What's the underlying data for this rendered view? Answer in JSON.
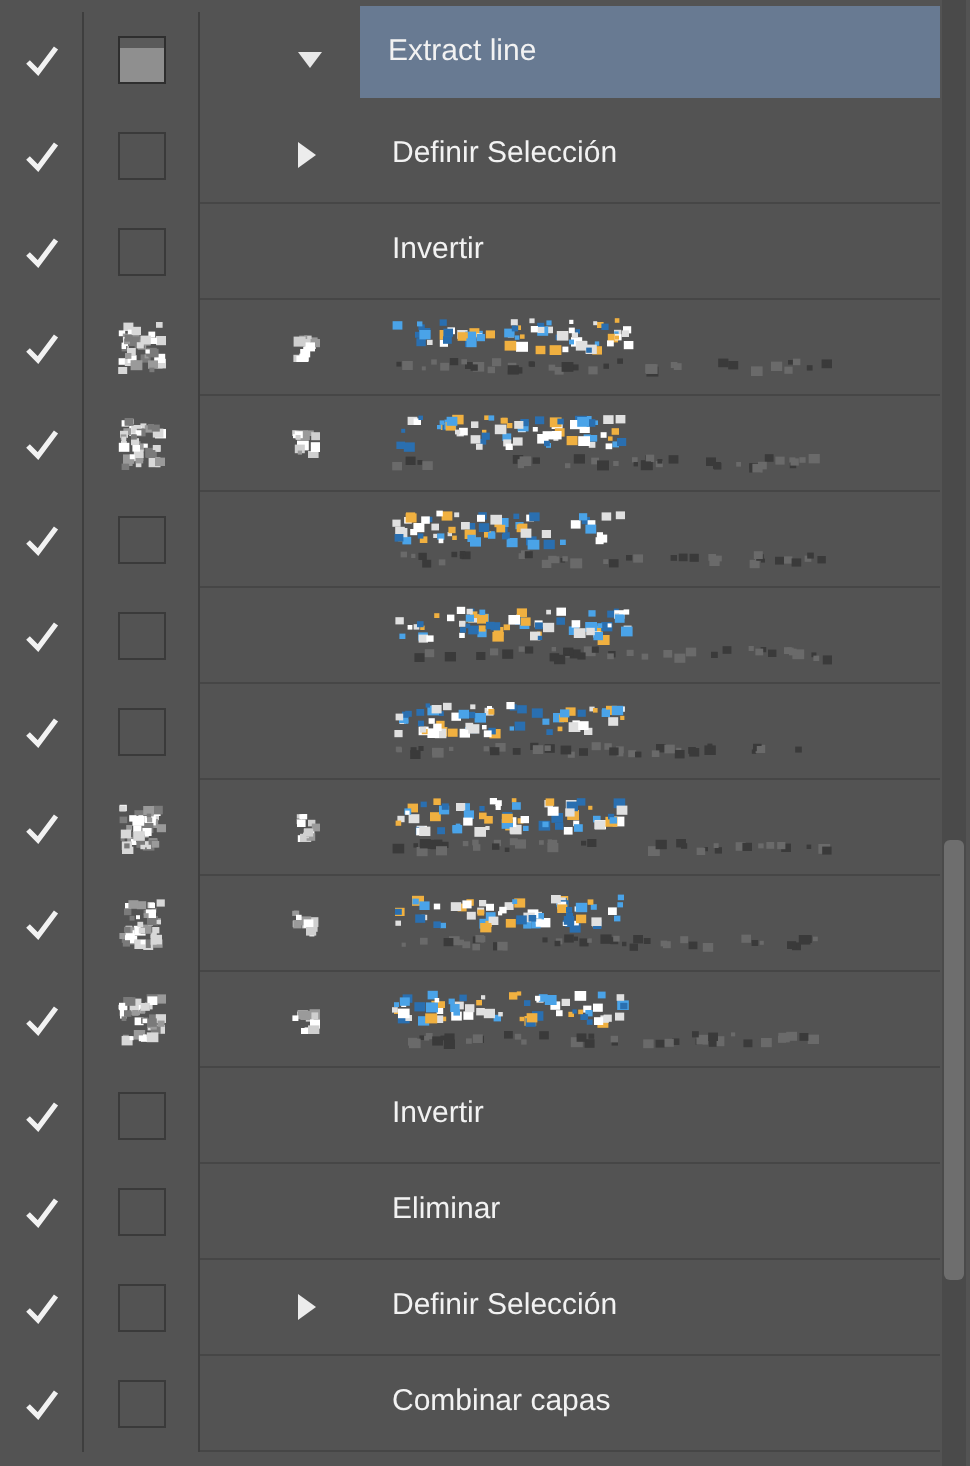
{
  "action": {
    "label": "Extract line",
    "selected": true,
    "expanded": true,
    "checked": true,
    "dialog": true,
    "children": [
      {
        "kind": "step",
        "label": "Definir Selección",
        "checked": true,
        "dialog": false,
        "expandable": true
      },
      {
        "kind": "step",
        "label": "Invertir",
        "checked": true,
        "dialog": false,
        "expandable": false
      },
      {
        "kind": "garbled",
        "checked": true,
        "dialog": true,
        "expandable": true
      },
      {
        "kind": "garbled",
        "checked": true,
        "dialog": true,
        "expandable": true
      },
      {
        "kind": "garbled",
        "checked": true,
        "dialog": false,
        "expandable": false
      },
      {
        "kind": "garbled",
        "checked": true,
        "dialog": false,
        "expandable": false
      },
      {
        "kind": "garbled",
        "checked": true,
        "dialog": false,
        "expandable": false
      },
      {
        "kind": "garbled",
        "checked": true,
        "dialog": true,
        "expandable": true
      },
      {
        "kind": "garbled",
        "checked": true,
        "dialog": true,
        "expandable": true
      },
      {
        "kind": "garbled",
        "checked": true,
        "dialog": true,
        "expandable": true
      },
      {
        "kind": "step",
        "label": "Invertir",
        "checked": true,
        "dialog": false,
        "expandable": false
      },
      {
        "kind": "step",
        "label": "Eliminar",
        "checked": true,
        "dialog": false,
        "expandable": false
      },
      {
        "kind": "step",
        "label": "Definir Selección",
        "checked": true,
        "dialog": false,
        "expandable": true
      },
      {
        "kind": "step",
        "label": "Combinar capas",
        "checked": true,
        "dialog": false,
        "expandable": false
      }
    ]
  }
}
